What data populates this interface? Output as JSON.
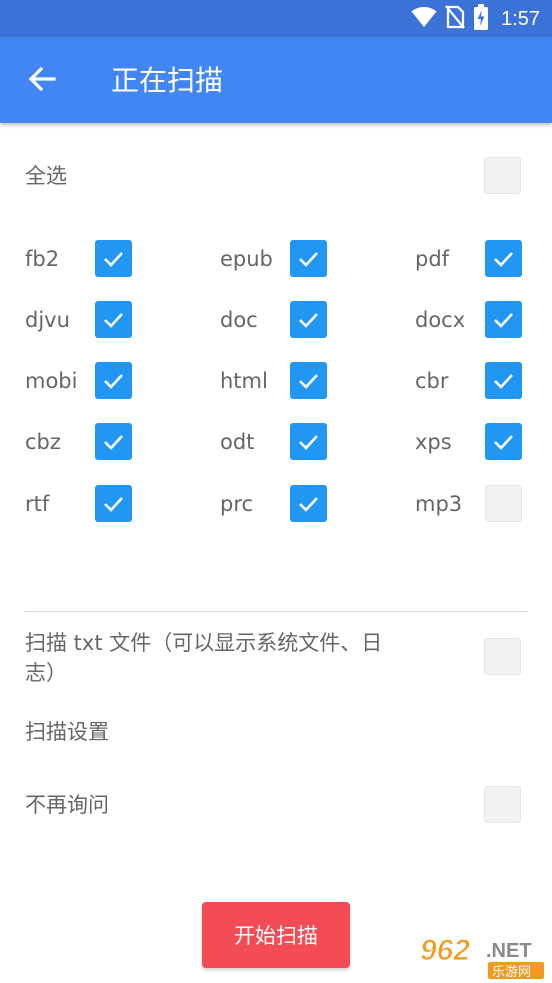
{
  "status_bar": {
    "time": "1:57",
    "icons": [
      "wifi-icon",
      "no-sim-icon",
      "battery-charging-icon"
    ]
  },
  "app_bar": {
    "title": "正在扫描",
    "back_icon": "arrow-left-icon"
  },
  "select_all": {
    "label": "全选",
    "checked": false
  },
  "formats": [
    {
      "label": "fb2",
      "checked": true
    },
    {
      "label": "epub",
      "checked": true
    },
    {
      "label": "pdf",
      "checked": true
    },
    {
      "label": "djvu",
      "checked": true
    },
    {
      "label": "doc",
      "checked": true
    },
    {
      "label": "docx",
      "checked": true
    },
    {
      "label": "mobi",
      "checked": true
    },
    {
      "label": "html",
      "checked": true
    },
    {
      "label": "cbr",
      "checked": true
    },
    {
      "label": "cbz",
      "checked": true
    },
    {
      "label": "odt",
      "checked": true
    },
    {
      "label": "xps",
      "checked": true
    },
    {
      "label": "rtf",
      "checked": true
    },
    {
      "label": "prc",
      "checked": true
    },
    {
      "label": "mp3",
      "checked": false
    }
  ],
  "scan_txt": {
    "label_line1": "扫描 txt 文件（可以显示系统文件、日",
    "label_line2": "志）",
    "checked": false
  },
  "scan_settings": {
    "label": "扫描设置"
  },
  "dont_ask": {
    "label": "不再询问",
    "checked": false
  },
  "start_button": {
    "label": "开始扫描"
  },
  "watermark": {
    "text_top": "962",
    "text_net": ".NET",
    "text_bottom": "乐游网"
  },
  "colors": {
    "status_bar": "#3b73d9",
    "app_bar": "#4285f4",
    "checkbox_checked": "#2196f3",
    "start_button": "#f44c55"
  }
}
